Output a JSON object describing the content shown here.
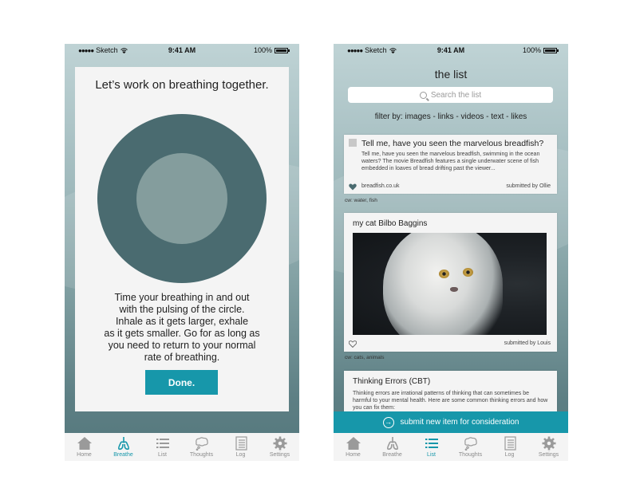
{
  "status_bar": {
    "carrier": "Sketch",
    "time": "9:41 AM",
    "battery": "100%"
  },
  "breathe_screen": {
    "title": "Let’s work on breathing together.",
    "instructions": "Time your breathing in and out\nwith the pulsing of the circle.\nInhale as it gets larger, exhale\nas it gets smaller. Go for as long as\nyou need to return to your normal\nrate of breathing.",
    "done_label": "Done."
  },
  "list_screen": {
    "title": "the list",
    "search_placeholder": "Search the list",
    "filter": "filter by: images - links - videos - text - likes",
    "items": [
      {
        "title": "Tell me, have you seen the marvelous breadfish?",
        "body": "Tell me, have you seen the marvelous breadfish, swimming in the ocean waters? The movie Breadfish features a single underwater scene of fish embedded in loaves of bread drifting past the viewer...",
        "link": "breadfish.co.uk",
        "submitted_by": "submitted by Ollie",
        "cw": "cw: water, fish"
      },
      {
        "title": "my cat Bilbo Baggins",
        "submitted_by": "submitted by Louis",
        "cw": "cw: cats, animals"
      },
      {
        "title": "Thinking Errors (CBT)",
        "body": "Thinking errors are irrational patterns of thinking that can sometimes be harmful to your mental health. Here are some common thinking errors and how you can fix them:"
      }
    ],
    "submit_label": "submit new item for consideration"
  },
  "tabs": [
    "Home",
    "Breathe",
    "List",
    "Thoughts",
    "Log",
    "Settings"
  ],
  "colors": {
    "accent": "#1797aa",
    "circle_outer": "#4a6b70",
    "circle_inner": "#849d9d",
    "tab_inactive": "#8a8a8a"
  }
}
